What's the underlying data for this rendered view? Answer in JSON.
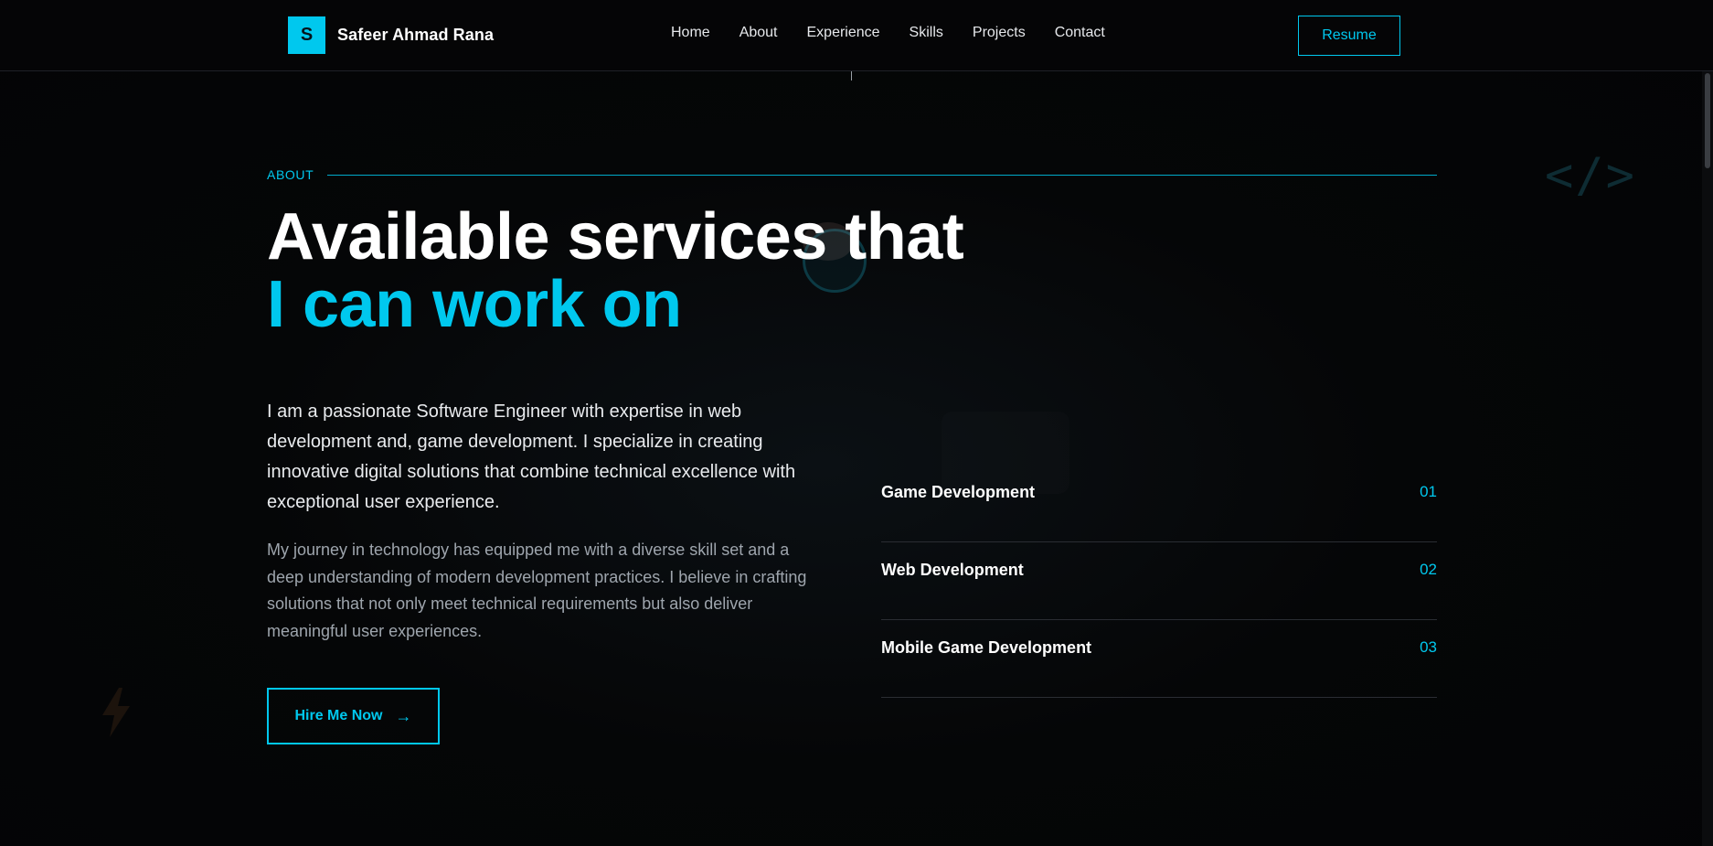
{
  "nav": {
    "logo_letter": "S",
    "brand_name": "Safeer Ahmad Rana",
    "links": [
      "Home",
      "About",
      "Experience",
      "Skills",
      "Projects",
      "Contact"
    ],
    "resume_label": "Resume"
  },
  "about": {
    "eyebrow": "ABOUT",
    "headline_line1": "Available services that",
    "headline_line2": "I can work on",
    "intro": "I am a passionate Software Engineer with expertise in web development and, game development. I specialize in creating innovative digital solutions that combine technical excellence with exceptional user experience.",
    "journey": "My journey in technology has equipped me with a diverse skill set and a deep understanding of modern development practices. I believe in crafting solutions that not only meet technical requirements but also deliver meaningful user experiences.",
    "cta_label": "Hire Me Now",
    "cta_arrow": "→"
  },
  "services": [
    {
      "title": "Game Development",
      "num": "01"
    },
    {
      "title": "Web Development",
      "num": "02"
    },
    {
      "title": "Mobile Game Development",
      "num": "03"
    }
  ],
  "decor": {
    "code_symbol": "</>",
    "icons": [
      "code-icon",
      "lightning-icon",
      "arrow-right-icon"
    ]
  },
  "colors": {
    "accent": "#00c8ee",
    "background": "#040506",
    "text": "#ffffff",
    "muted_text": "#9ea5ad"
  }
}
